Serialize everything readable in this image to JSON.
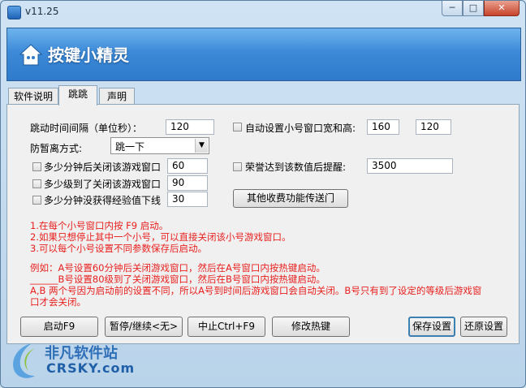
{
  "window": {
    "title": "v11.25",
    "controls": {
      "minimize": "─",
      "maximize": "□",
      "close": "✕"
    }
  },
  "banner": {
    "title": "按键小精灵"
  },
  "tabs": [
    {
      "label": "软件说明",
      "active": false
    },
    {
      "label": "跳跳",
      "active": true
    },
    {
      "label": "声明",
      "active": false
    }
  ],
  "form": {
    "jump_interval": {
      "label": "跳动时间间隔（单位秒）：",
      "value": "120"
    },
    "auto_size": {
      "label": "自动设置小号窗口宽和高:",
      "width": "160",
      "height": "120",
      "checked": false
    },
    "anti_stuck": {
      "label": "防暂离方式:",
      "selected": "跳一下"
    },
    "close_after_minutes": {
      "label": "多少分钟后关闭该游戏窗口",
      "value": "60",
      "checked": false
    },
    "close_at_level": {
      "label": "多少级到了关闭该游戏窗口",
      "value": "90",
      "checked": false
    },
    "offline_no_exp": {
      "label": "多少分钟没获得经验值下线",
      "value": "30",
      "checked": false
    },
    "honor_alert": {
      "label": "荣誉达到该数值后提醒:",
      "value": "3500",
      "checked": false
    },
    "other_features_button": "其他收费功能传送门"
  },
  "notes": [
    "1.在每个小号窗口内按 F9 启动。",
    "2.如果只想停止其中一个小号，可以直接关闭该小号游戏窗口。",
    "3.可以每个小号设置不同参数保存后启动。"
  ],
  "examples": [
    "例如：A号设置60分钟后关闭游戏窗口，然后在A号窗口内按热键启动。",
    "______B号设置80级到了关闭游戏窗口，然后在B号窗口内按热键启动。",
    "A,B 两个号因为启动前的设置不同，所以A号到时间后游戏窗口会自动关闭。B号只有到了设定的等级后游戏窗",
    "口才会关闭。"
  ],
  "buttons": {
    "start": "启动F9",
    "pause": "暂停/继续<无>",
    "stop": "中止Ctrl+F9",
    "hotkey": "修改热键",
    "save": "保存设置",
    "restore": "还原设置"
  },
  "watermark": {
    "cn": "非凡软件站",
    "en": "CRSKY.com"
  },
  "colors": {
    "note_red": "#e8201e",
    "banner_blue": "#3c8ad8"
  }
}
